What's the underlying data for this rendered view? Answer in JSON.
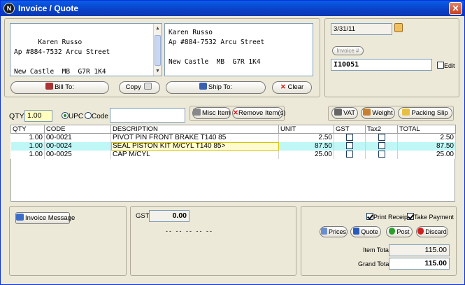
{
  "window": {
    "title": "Invoice / Quote",
    "close": "✕",
    "app_icon": "N"
  },
  "bill_to": {
    "text": "Karen Russo\nAp #884-7532 Arcu Street\n\nNew Castle  MB  G7R 1K4"
  },
  "ship_to": {
    "text": "Karen Russo\nAp #884-7532 Arcu Street\n\nNew Castle  MB  G7R 1K4"
  },
  "buttons": {
    "bill_to": "Bill To:",
    "copy": "Copy",
    "ship_to": "Ship To:",
    "clear": "Clear",
    "invoice_no": "Invoice #",
    "misc_item": "Misc Item",
    "remove_items": "Remove Item(s)",
    "vat": "VAT",
    "weight": "Weight",
    "packing_slip": "Packing Slip",
    "invoice_message": "Invoice Message",
    "prices": "Prices",
    "quote": "Quote",
    "post": "Post",
    "discard": "Discard"
  },
  "date": "3/31/11",
  "invoice_number": "I10051",
  "edit_label": "Edit",
  "entry": {
    "qty_label": "QTY",
    "qty_value": "1.00",
    "upc_label": "UPC",
    "code_label": "Code",
    "search_value": ""
  },
  "table": {
    "headers": [
      "QTY",
      "CODE",
      "DESCRIPTION",
      "UNIT",
      "GST",
      "Tax2",
      "TOTAL"
    ],
    "rows": [
      {
        "qty": "1.00",
        "code": "00-0021",
        "desc": "PIVOT PIN FRONT BRAKE T140 85",
        "unit": "2.50",
        "total": "2.50"
      },
      {
        "qty": "1.00",
        "code": "00-0024",
        "desc": "SEAL PISTON KIT M/CYL T140 85>",
        "unit": "87.50",
        "total": "87.50"
      },
      {
        "qty": "1.00",
        "code": "00-0025",
        "desc": "CAP M/CYL",
        "unit": "25.00",
        "total": "25.00"
      }
    ]
  },
  "tax": {
    "gst_label": "GST",
    "gst_value": "0.00",
    "dashes": "-- -- -- -- --"
  },
  "options": {
    "print_receipt": "Print Receipt",
    "take_payment": "Take Payment"
  },
  "totals": {
    "item_total_label": "Item Total",
    "item_total": "115.00",
    "grand_total_label": "Grand Total",
    "grand_total": "115.00"
  },
  "colors": {
    "title_bar": "#0a4fd8",
    "selected_row": "#bff7f7",
    "qty_field": "#ffffc0"
  }
}
